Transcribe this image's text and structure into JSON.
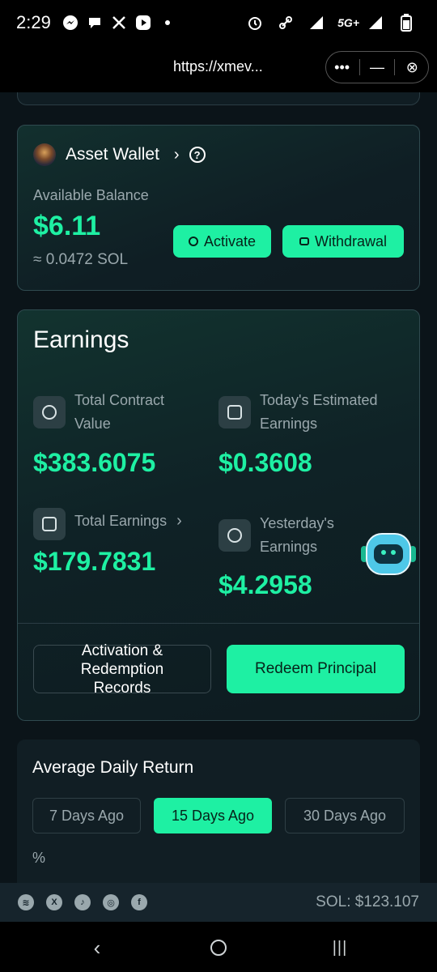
{
  "status_bar": {
    "time": "2:29",
    "network": "5G+"
  },
  "browser": {
    "url": "https://xmev...",
    "more_label": "•••",
    "minimize_label": "—",
    "close_label": "⊗"
  },
  "wallet": {
    "title": "Asset Wallet",
    "balance_label": "Available Balance",
    "balance_value": "$6.11",
    "balance_sol": "≈ 0.0472 SOL",
    "activate_label": "Activate",
    "withdrawal_label": "Withdrawal"
  },
  "earnings": {
    "title": "Earnings",
    "total_contract_label": "Total Contract Value",
    "total_contract_value": "$383.6075",
    "today_label": "Today's Estimated Earnings",
    "today_value": "$0.3608",
    "total_earnings_label": "Total Earnings",
    "total_earnings_value": "$179.7831",
    "yesterday_label": "Yesterday's Earnings",
    "yesterday_value": "$4.2958",
    "records_label": "Activation & Redemption Records",
    "redeem_label": "Redeem Principal"
  },
  "average_daily_return": {
    "title": "Average Daily Return",
    "tabs": [
      {
        "label": "7 Days Ago",
        "active": false
      },
      {
        "label": "15 Days Ago",
        "active": true
      },
      {
        "label": "30 Days Ago",
        "active": false
      }
    ],
    "unit": "%"
  },
  "footer": {
    "social_icons": [
      "layers-icon",
      "x-icon",
      "tiktok-icon",
      "instagram-icon",
      "facebook-icon"
    ],
    "sol_price": "SOL: $123.107"
  },
  "colors": {
    "accent": "#1ef0a3",
    "background": "#0b1419",
    "muted_text": "#9aa8ad"
  }
}
